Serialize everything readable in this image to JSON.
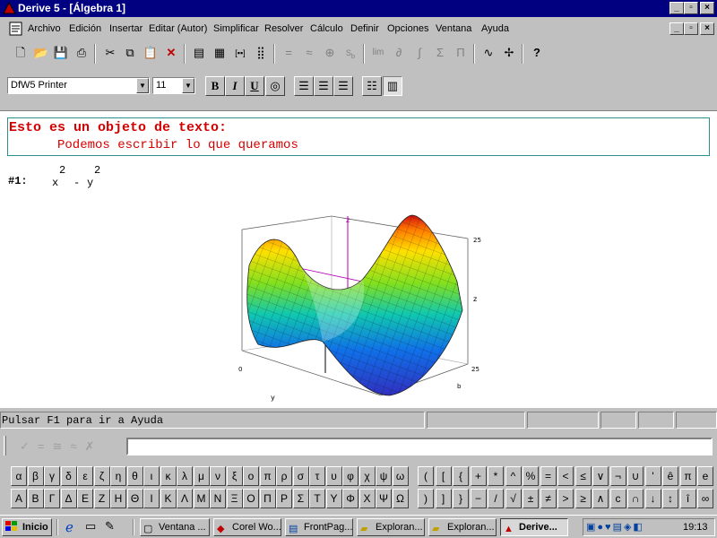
{
  "window": {
    "title": "Derive 5 - [Álgebra 1]",
    "controls": {
      "minimize": "_",
      "maximize": "▫",
      "close": "×"
    }
  },
  "menubar": {
    "items": [
      "Archivo",
      "Edición",
      "Insertar",
      "Editar (Autor)",
      "Simplificar",
      "Resolver",
      "Cálculo",
      "Definir",
      "Opciones",
      "Ventana",
      "Ayuda"
    ]
  },
  "toolbar2": {
    "font_name": "DfW5 Printer",
    "font_size": "11"
  },
  "document": {
    "text_object": {
      "line1": "Esto es un objeto de texto:",
      "line2": "Podemos escribir lo que queramos"
    },
    "expression": {
      "label": "#1:",
      "base1": "x",
      "exp1": "2",
      "op": "-",
      "base2": "y",
      "exp2": "2"
    },
    "plot_labels": {
      "z_top": "z",
      "z_right": "z",
      "tick_top": "25",
      "tick_bottom": "25",
      "axis_y": "y",
      "neg": "0",
      "pos": "b"
    }
  },
  "status": {
    "text": "Pulsar F1 para ir a Ayuda"
  },
  "symbols": {
    "greek_lower": [
      "α",
      "β",
      "γ",
      "δ",
      "ε",
      "ζ",
      "η",
      "θ",
      "ι",
      "κ",
      "λ",
      "μ",
      "ν",
      "ξ",
      "ο",
      "π",
      "ρ",
      "σ",
      "τ",
      "υ",
      "φ",
      "χ",
      "ψ",
      "ω"
    ],
    "greek_upper": [
      "Α",
      "Β",
      "Γ",
      "Δ",
      "Ε",
      "Ζ",
      "Η",
      "Θ",
      "Ι",
      "Κ",
      "Λ",
      "Μ",
      "Ν",
      "Ξ",
      "Ο",
      "Π",
      "Ρ",
      "Σ",
      "Τ",
      "Υ",
      "Φ",
      "Χ",
      "Ψ",
      "Ω"
    ],
    "ops_row1": [
      "(",
      "[",
      "{",
      "+",
      "*",
      "^",
      "%",
      "=",
      "<",
      "≤",
      "∨",
      "¬",
      "∪",
      "'",
      "ê",
      "π",
      "e"
    ],
    "ops_row2": [
      ")",
      "]",
      "}",
      "−",
      "/",
      "√",
      "±",
      "≠",
      ">",
      "≥",
      "∧",
      "c",
      "∩",
      "↓",
      "↕",
      "î",
      "∞"
    ]
  },
  "taskbar": {
    "start": "Inicio",
    "tasks": [
      "Ventana ...",
      "Corel Wo...",
      "FrontPag...",
      "Exploran...",
      "Exploran...",
      "Derive..."
    ],
    "clock": "19:13"
  },
  "colors": {
    "title_bg": "#000080",
    "text_object": "#d40000",
    "text_frame": "#2f8f8f",
    "face": "#c0c0c0"
  }
}
